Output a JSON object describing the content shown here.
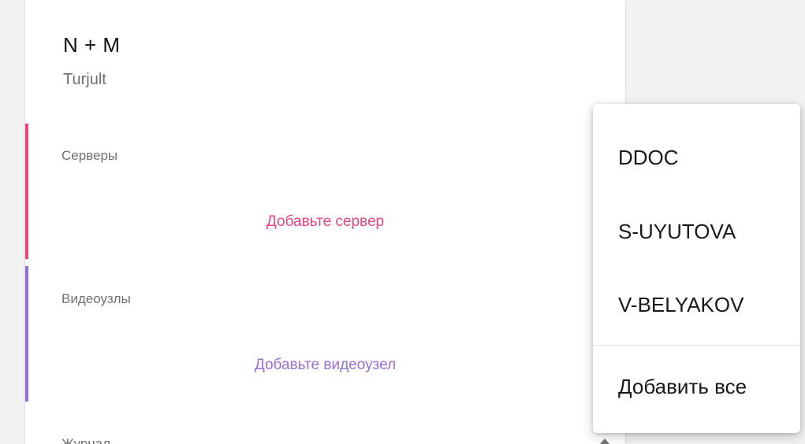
{
  "header": {
    "title": "N + M",
    "subtitle": "Turjult"
  },
  "sections": [
    {
      "label": "Серверы",
      "add_label": "Добавьте сервер",
      "accent_color": "#e8457f"
    },
    {
      "label": "Видеоузлы",
      "add_label": "Добавьте видеоузел",
      "accent_color": "#9b6dd6"
    }
  ],
  "journal": {
    "label": "Журнал",
    "icon": "chevron-up-icon"
  },
  "dropdown": {
    "items": [
      "DDOC",
      "S-UYUTOVA",
      "V-BELYAKOV"
    ],
    "add_all_label": "Добавить все"
  }
}
